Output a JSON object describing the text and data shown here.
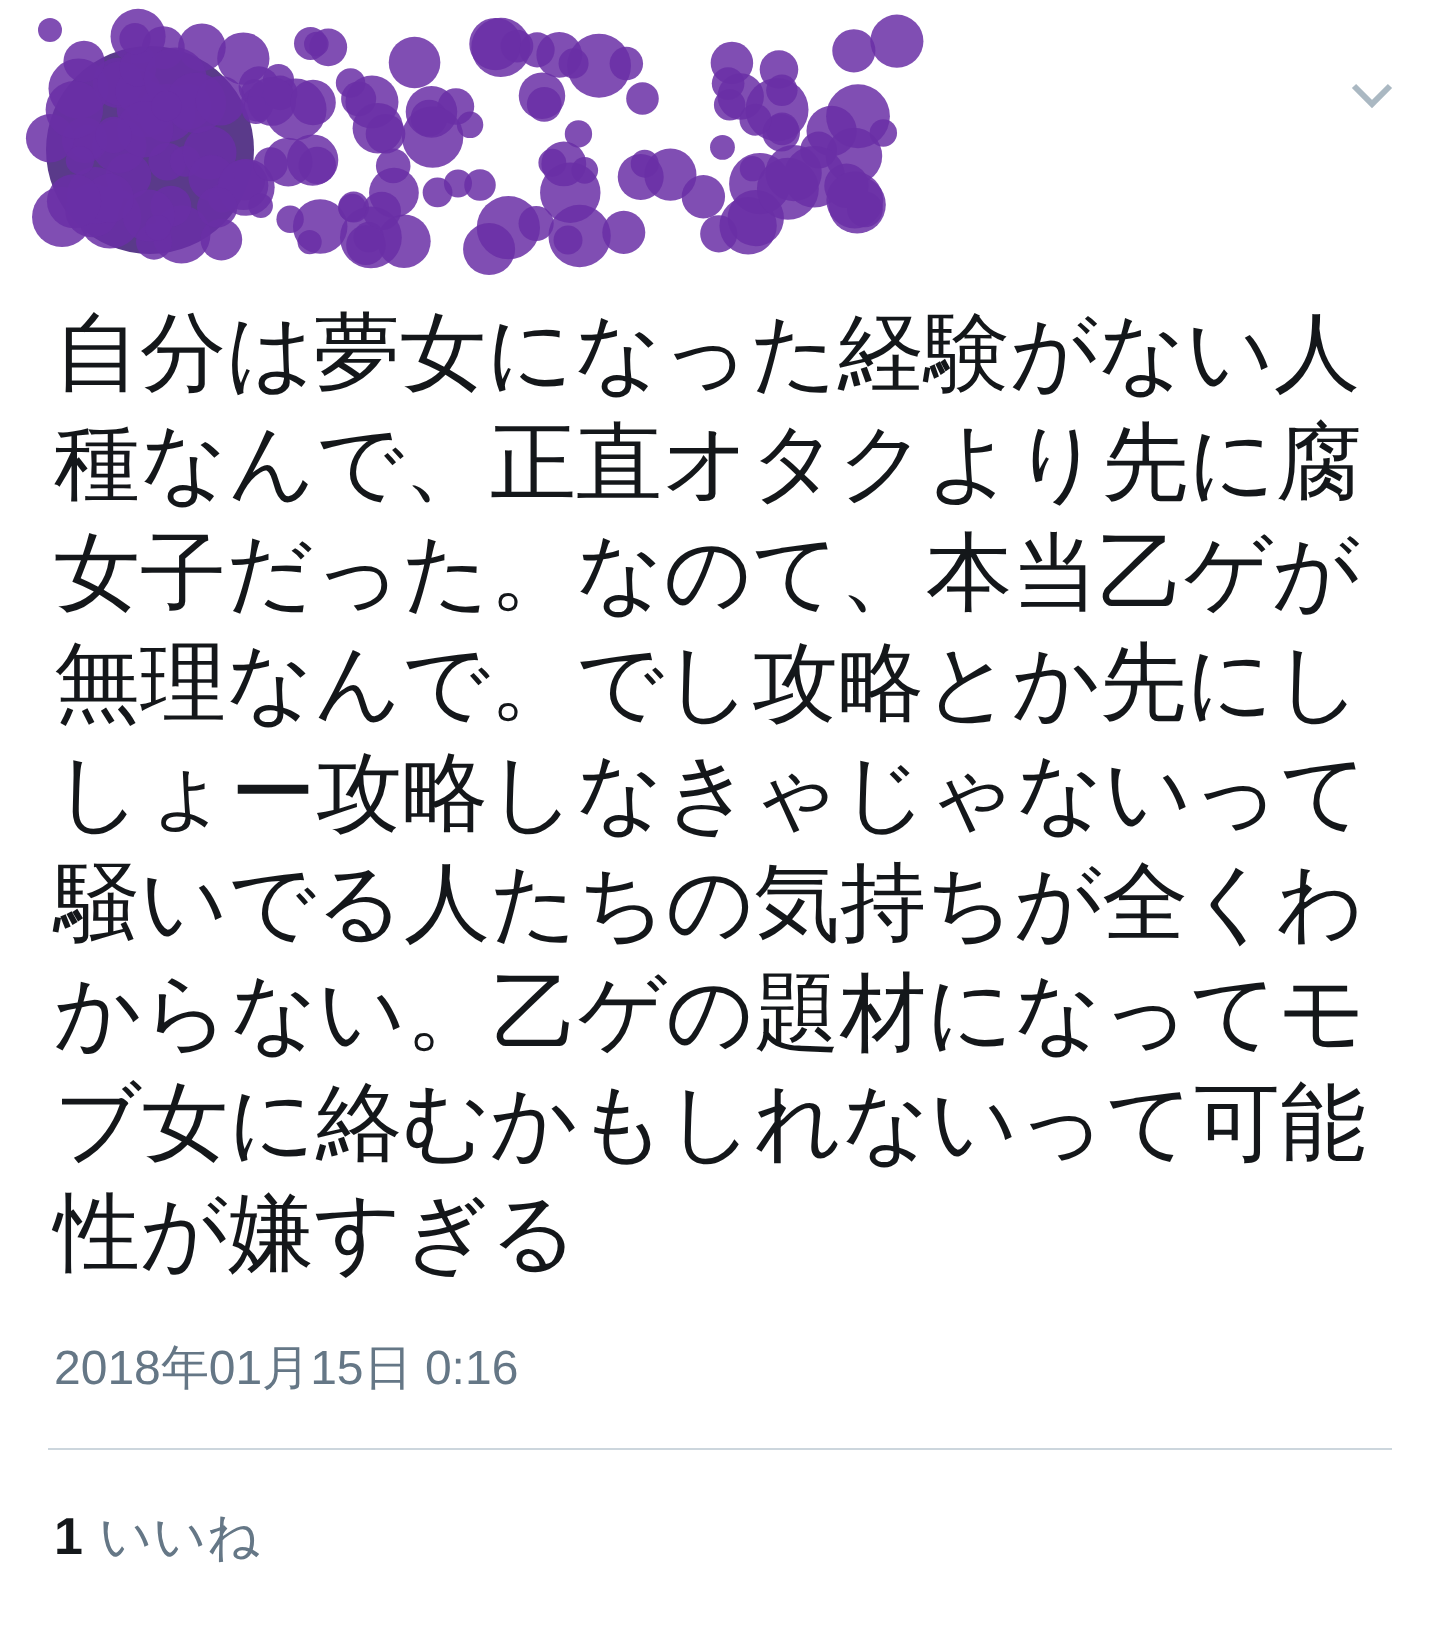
{
  "tweet": {
    "text": "自分は夢女になった経験がない人種なんで、正直オタクより先に腐女子だった。なのて、本当乙ゲが無理なんで。でし攻略とか先にししょー攻略しなきゃじゃないって騒いでる人たちの気持ちが全くわからない。乙ゲの題材になってモブ女に絡むかもしれないって可能性が嫌すぎる",
    "timestamp": "2018年01月15日 0:16",
    "likes": {
      "count": "1",
      "label": "いいね"
    }
  }
}
